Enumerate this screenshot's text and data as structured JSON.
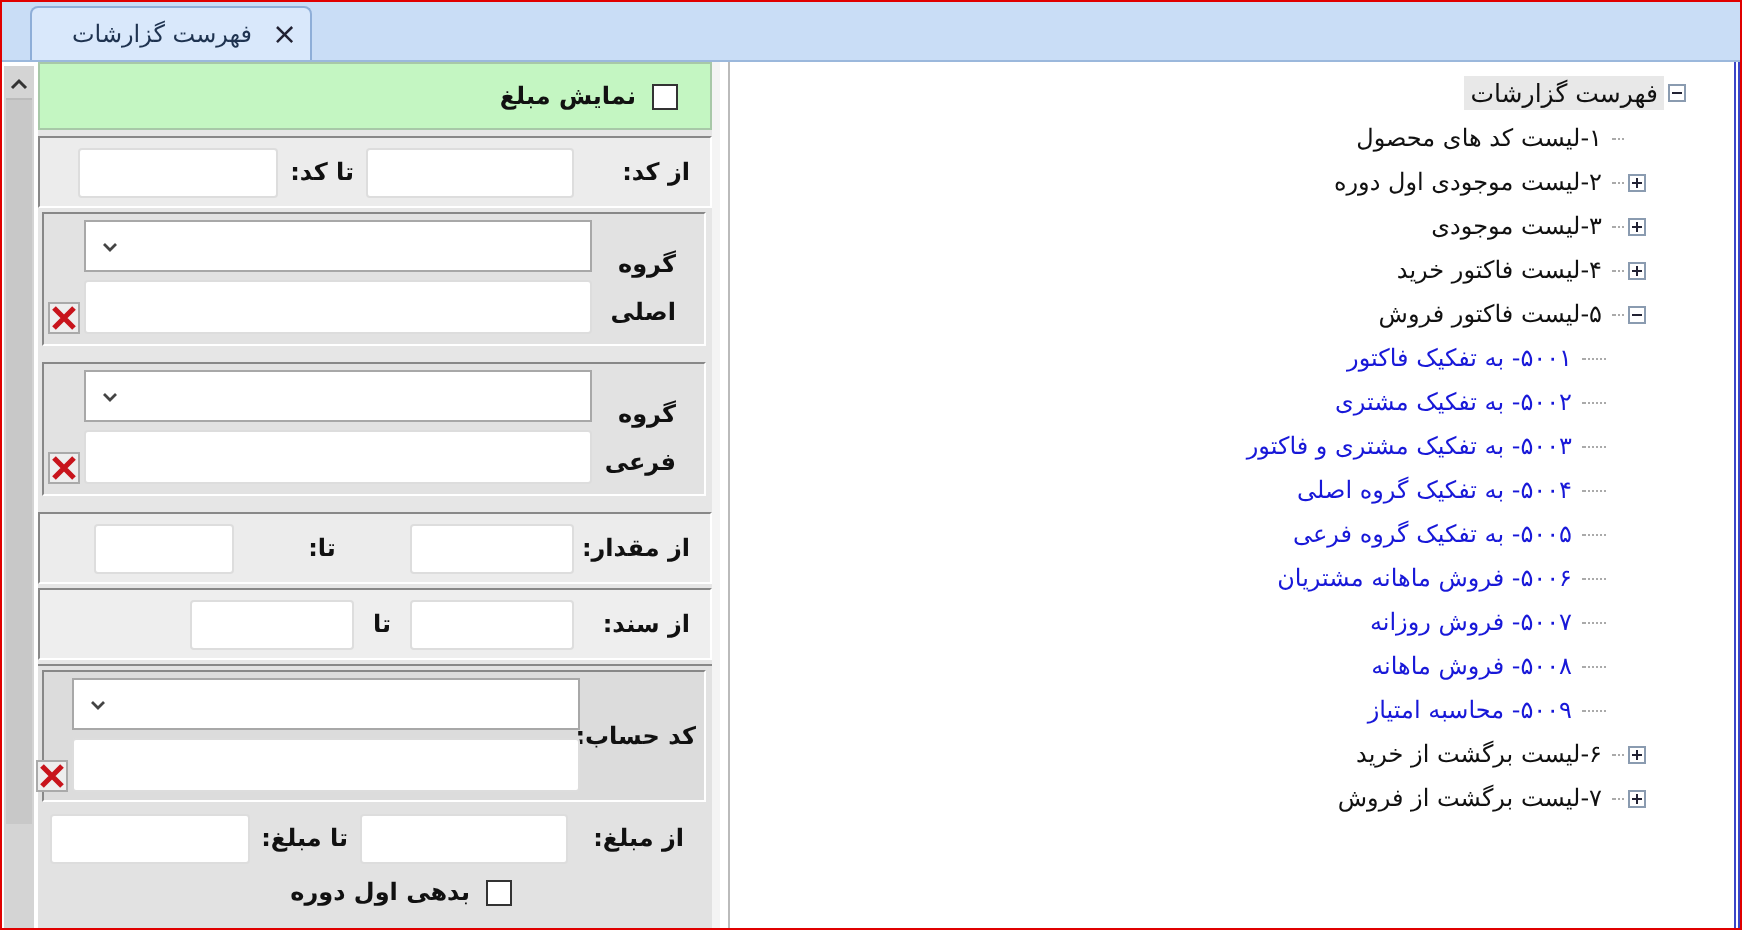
{
  "tab": {
    "title": "فهرست گزارشات",
    "close": "×"
  },
  "form": {
    "show_amount": {
      "label": "نمایش مبلغ",
      "checked": false
    },
    "code_range": {
      "from_label": "از کد:",
      "to_label": "تا کد:"
    },
    "groups": [
      {
        "label": "گروه اصلی"
      },
      {
        "label": "گروه فرعی"
      }
    ],
    "quantity_range": {
      "from_label": "از مقدار:",
      "to_label": "تا:"
    },
    "document_range": {
      "from_label": "از سند:",
      "to_label": "تا"
    },
    "account": {
      "label": "کد حساب:"
    },
    "amount_range": {
      "from_label": "از مبلغ:",
      "to_label": "تا مبلغ:"
    },
    "opening_debt": {
      "label": "بدهی اول دوره",
      "checked": false
    }
  },
  "tree": {
    "label": "فهرست گزارشات",
    "expanded": true,
    "selected": true,
    "children": [
      {
        "label": "۱-لیست کد های محصول",
        "selected": false
      },
      {
        "label": "۲-لیست موجودی اول دوره",
        "expanded": false,
        "selected": false
      },
      {
        "label": "۳-لیست موجودی",
        "expanded": false,
        "selected": false
      },
      {
        "label": "۴-لیست فاکتور خرید",
        "expanded": false,
        "selected": false
      },
      {
        "label": "۵-لیست فاکتور فروش",
        "expanded": true,
        "selected": false,
        "children": [
          {
            "label": "۵۰۰۱- به تفکیک فاکتور",
            "selected": false
          },
          {
            "label": "۵۰۰۲- به تفکیک مشتری",
            "selected": false
          },
          {
            "label": "۵۰۰۳- به تفکیک مشتری و فاکتور",
            "selected": false
          },
          {
            "label": "۵۰۰۴- به تفکیک گروه اصلی",
            "selected": false
          },
          {
            "label": "۵۰۰۵- به تفکیک گروه فرعی",
            "selected": false
          },
          {
            "label": "۵۰۰۶- فروش ماهانه مشتریان",
            "selected": false
          },
          {
            "label": "۵۰۰۷- فروش روزانه",
            "selected": false
          },
          {
            "label": "۵۰۰۸- فروش ماهانه",
            "selected": false
          },
          {
            "label": "۵۰۰۹- محاسبه امتیاز",
            "selected": false
          }
        ]
      },
      {
        "label": "۶-لیست برگشت از خرید",
        "expanded": false,
        "selected": false
      },
      {
        "label": "۷-لیست برگشت از فروش",
        "expanded": false,
        "selected": false
      }
    ]
  }
}
